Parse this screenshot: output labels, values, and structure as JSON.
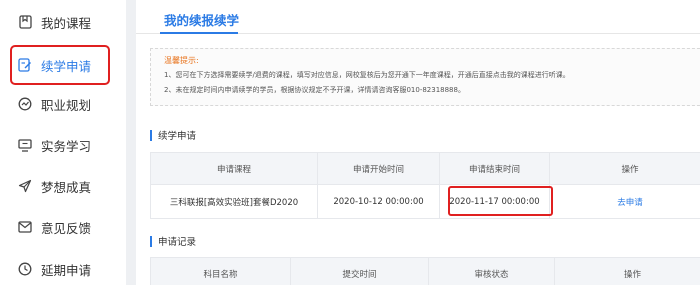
{
  "sidebar": {
    "items": [
      {
        "label": "我的课程",
        "icon": "bookmark-icon"
      },
      {
        "label": "续学申请",
        "icon": "apply-edit-icon",
        "active": true
      },
      {
        "label": "职业规划",
        "icon": "compass-icon"
      },
      {
        "label": "实务学习",
        "icon": "monitor-icon"
      },
      {
        "label": "梦想成真",
        "icon": "paper-plane-icon"
      },
      {
        "label": "意见反馈",
        "icon": "mail-icon"
      },
      {
        "label": "延期申请",
        "icon": "clock-icon"
      }
    ]
  },
  "main": {
    "title": "我的续报续学",
    "notice": {
      "title": "温馨提示:",
      "lines": [
        "1、您可在下方选择需要续学/退费的课程，填写对应信息，网校复核后为您开通下一年度课程，开通后直接点击我的课程进行听课。",
        "2、未在规定时间内申请续学的学员，根据协议规定不予开课，详情请咨询客服010-82318888。"
      ]
    },
    "apply_section": {
      "title": "续学申请",
      "headers": [
        "申请课程",
        "申请开始时间",
        "申请结束时间",
        "操作"
      ],
      "rows": [
        {
          "course": "三科联报[高效实验班]套餐D2020",
          "start": "2020-10-12 00:00:00",
          "end": "2020-11-17 00:00:00",
          "action": "去申请"
        }
      ]
    },
    "record_section": {
      "title": "申请记录",
      "headers": [
        "科目名称",
        "提交时间",
        "审核状态",
        "操作"
      ]
    }
  },
  "colors": {
    "accent": "#2b7be5",
    "highlight": "#e02020",
    "notice_title": "#e8731c"
  }
}
